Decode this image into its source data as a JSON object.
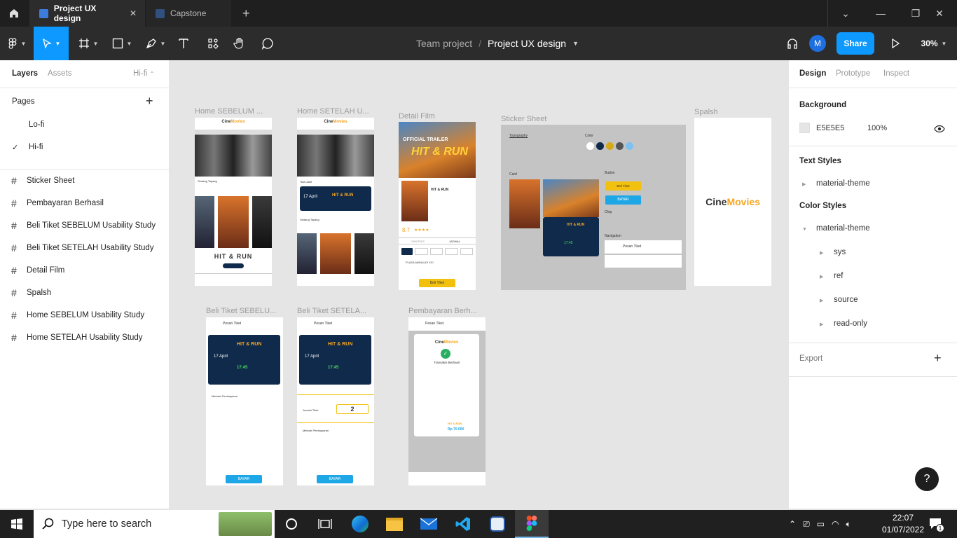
{
  "tabs": [
    {
      "label": "Project UX design",
      "active": true
    },
    {
      "label": "Capstone",
      "active": false
    }
  ],
  "toolbar": {
    "breadcrumb_team": "Team project",
    "breadcrumb_sep": "/",
    "file_name": "Project UX design",
    "avatar_initial": "M",
    "share_label": "Share",
    "zoom": "30%"
  },
  "left_panel": {
    "tabs": [
      "Layers",
      "Assets"
    ],
    "page_selector": "Hi-fi",
    "pages_title": "Pages",
    "pages": [
      {
        "label": "Lo-fi",
        "selected": false
      },
      {
        "label": "Hi-fi",
        "selected": true
      }
    ],
    "layers": [
      "Sticker Sheet",
      "Pembayaran Berhasil",
      "Beli Tiket SEBELUM Usability Study",
      "Beli Tiket SETELAH Usability Study",
      "Detail Film",
      "Spalsh",
      "Home SEBELUM Usability Study",
      "Home SETELAH Usability Study"
    ]
  },
  "right_panel": {
    "tabs": [
      "Design",
      "Prototype",
      "Inspect"
    ],
    "background_title": "Background",
    "bg_color": "E5E5E5",
    "bg_opacity": "100%",
    "text_styles_title": "Text Styles",
    "text_styles": [
      "material-theme"
    ],
    "color_styles_title": "Color Styles",
    "color_styles_group": "material-theme",
    "color_styles_children": [
      "sys",
      "ref",
      "source",
      "read-only"
    ],
    "export_title": "Export",
    "help": "?"
  },
  "canvas": {
    "frame_labels": [
      "Home SEBELUM ...",
      "Home SETELAH U...",
      "Detail Film",
      "Sticker Sheet",
      "Spalsh",
      "Beli Tiket SEBELU...",
      "Beli Tiket SETELA...",
      "Pembayaran Berh..."
    ],
    "brand_cine": "Cine",
    "brand_movies": "Movies",
    "movie_title": "HIT & RUN",
    "date_day": "17 April",
    "date_year": "2022",
    "time": "17:45",
    "pesan_tiket": "Pesan Tiket",
    "bayar": "BAYAR",
    "metode": "Metode Pembayaran",
    "jumlah_tiket": "Jumlah Tiket",
    "qty": "2",
    "transaksi": "Transaksi Berhasil",
    "price": "Rp 70.000",
    "beli_tiket": "Beli Tiket",
    "official_trailer": "OFFICIAL TRAILER",
    "rating": "8.7",
    "sinopsis": "SINOPSIS",
    "jadwal": "JADWAL",
    "plaza": "PLAZA ANDALAS XXI",
    "typography": "Typography",
    "color": "Color",
    "card": "Card",
    "button": "Button",
    "chip": "Chip",
    "navigation": "Navigation",
    "sedang_tayang": "Sedang Tayang",
    "tiket_aktif": "Tiket Aktif",
    "padang": "PADANG"
  },
  "taskbar": {
    "search_placeholder": "Type here to search",
    "time": "22:07",
    "date": "01/07/2022",
    "notif_count": "1"
  },
  "colors": {
    "accent": "#0d99ff",
    "figma_dark": "#2c2c2c",
    "navy": "#0f2a4a",
    "orange": "#f5a623",
    "green": "#27ae60"
  }
}
